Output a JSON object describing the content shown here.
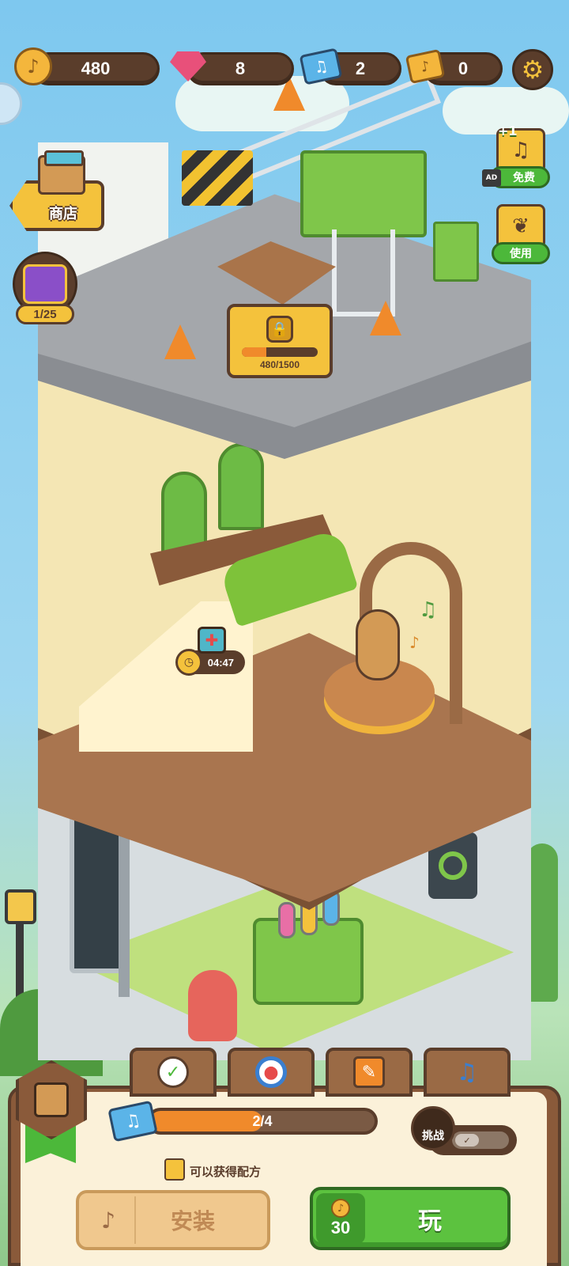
{
  "currencies": {
    "coins": "480",
    "gems": "8",
    "blue_tickets": "2",
    "gold_tickets": "0"
  },
  "left_menu": {
    "shop_label": "商店",
    "chest_count": "1/25"
  },
  "right_menu": {
    "free_plus": "+1",
    "ad_label": "AD",
    "free_label": "免费",
    "use_label": "使用"
  },
  "roof": {
    "unlock_progress_text": "480/1500",
    "unlock_progress": 0.32
  },
  "room": {
    "timer": "04:47"
  },
  "bottom": {
    "progress_text": "2/4",
    "progress": 0.5,
    "recipe_hint": "可以获得配方",
    "challenge_label": "挑战",
    "install_label": "安装",
    "play_cost": "30",
    "play_label": "玩"
  },
  "icons": {
    "settings": "gear-icon",
    "tabs": [
      "checklist-icon",
      "target-icon",
      "brush-book-icon",
      "music-list-icon"
    ]
  },
  "colors": {
    "accent_yellow": "#f4c23c",
    "brown": "#5a3d2b",
    "green": "#5cc23f",
    "orange": "#f08a2b"
  }
}
